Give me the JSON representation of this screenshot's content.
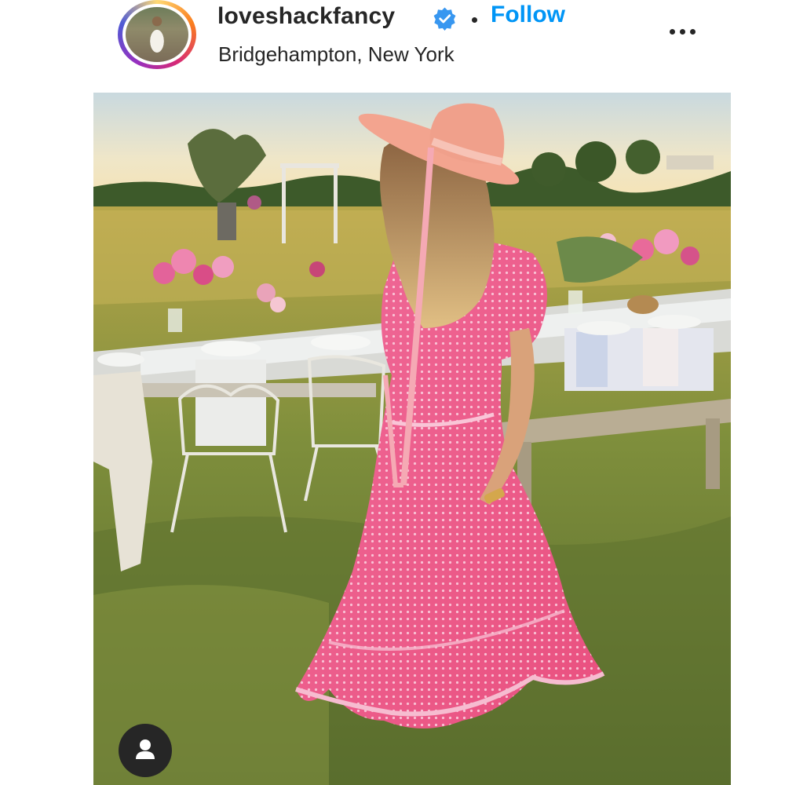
{
  "post_header": {
    "username": "loveshackfancy",
    "verified": true,
    "follow_label": "Follow",
    "location": "Bridgehampton, New York"
  },
  "icons": {
    "verified": "verified-badge-icon",
    "more": "more-options-icon",
    "tagged_users": "user-tag-icon"
  },
  "colors": {
    "follow_blue": "#0095f6",
    "verified_blue": "#3897f0",
    "text": "#262626"
  },
  "post": {
    "media_type": "photo"
  }
}
